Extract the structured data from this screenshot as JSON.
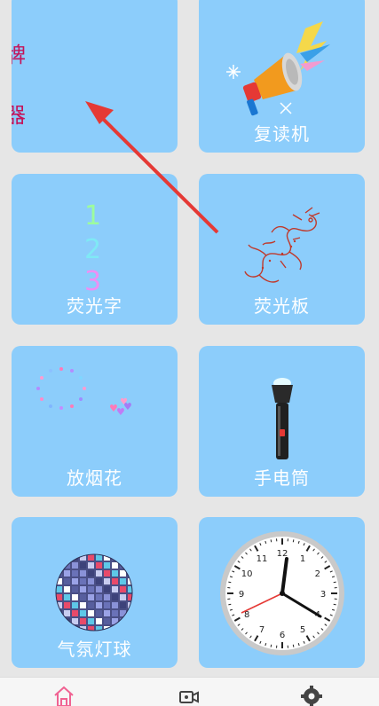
{
  "tiles": [
    {
      "label": "",
      "partial_text_1": "牌",
      "partial_text_2": "器"
    },
    {
      "label": "复读机",
      "icon": "megaphone-icon"
    },
    {
      "label": "荧光字",
      "digits": [
        "1",
        "2",
        "3"
      ]
    },
    {
      "label": "荧光板",
      "icon": "dragon-icon"
    },
    {
      "label": "放烟花",
      "icon": "fireworks-icon"
    },
    {
      "label": "手电筒",
      "icon": "flashlight-icon"
    },
    {
      "label": "气氛灯球",
      "icon": "disco-ball-icon"
    },
    {
      "label": "",
      "icon": "clock-icon",
      "clock_numbers": [
        "12",
        "1",
        "2",
        "3",
        "4",
        "5",
        "6",
        "7",
        "8",
        "9",
        "10",
        "11"
      ]
    }
  ],
  "bottom_nav": {
    "items": [
      "home-icon",
      "video-icon",
      "gear-icon"
    ]
  },
  "colors": {
    "tile": "#8ccdfb",
    "accent": "#e53935",
    "nav_active": "#f06292"
  }
}
